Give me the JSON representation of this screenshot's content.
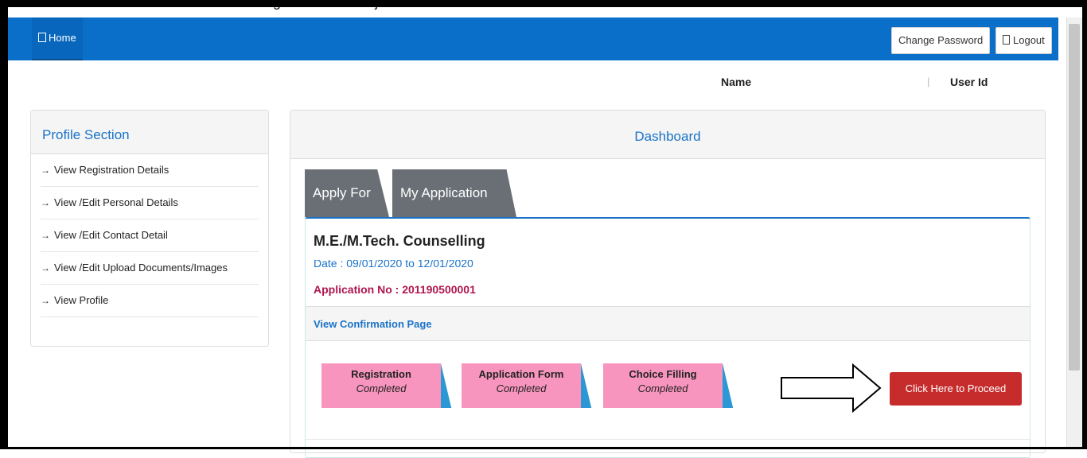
{
  "site": {
    "title": "Common Registration for Gujarat ACPC"
  },
  "nav": {
    "home_label": "Home",
    "change_password_label": "Change Password",
    "logout_label": "Logout"
  },
  "user": {
    "name_label": "Name",
    "separator": "|",
    "user_id_label": "User Id"
  },
  "profile": {
    "heading": "Profile Section",
    "items": [
      {
        "label": "View Registration Details"
      },
      {
        "label": "View /Edit Personal Details"
      },
      {
        "label": "View /Edit Contact Detail"
      },
      {
        "label": "View /Edit Upload Documents/Images"
      },
      {
        "label": "View Profile"
      }
    ]
  },
  "dashboard": {
    "heading": "Dashboard",
    "tabs": [
      {
        "label": "Apply For"
      },
      {
        "label": "My Application"
      }
    ],
    "application": {
      "course": "M.E./M.Tech. Counselling",
      "date_text": "Date : 09/01/2020 to 12/01/2020",
      "application_no": "Application No : 201190500001",
      "confirmation_link": "View Confirmation Page"
    },
    "steps": [
      {
        "title": "Registration",
        "status": "Completed"
      },
      {
        "title": "Application Form",
        "status": "Completed"
      },
      {
        "title": "Choice Filling",
        "status": "Completed"
      }
    ],
    "proceed_label": "Click Here to Proceed"
  },
  "colors": {
    "navbar": "#0a6fc8",
    "accent_blue": "#1a73c8",
    "step_pink": "#f895be",
    "step_wedge": "#2a98d4",
    "proceed_red": "#c72c2c",
    "app_no_maroon": "#b0164f",
    "tab_gray": "#6a6f76"
  }
}
